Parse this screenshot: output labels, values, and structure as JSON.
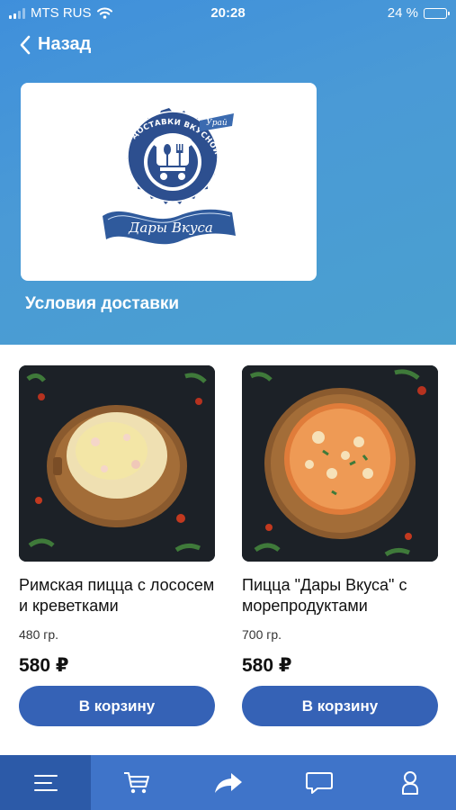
{
  "status_bar": {
    "carrier": "MTS RUS",
    "time": "20:28",
    "battery": "24 %",
    "battery_level": 0.24
  },
  "nav": {
    "back_label": "Назад"
  },
  "store": {
    "logo_arc_text": "СЛУЖБА ДОСТАВКИ ВКУСНОЙ ЕДЫ",
    "logo_ribbon_text": "Дары Вкуса",
    "logo_corner_text": "Урай",
    "delivery_link": "Условия доставки"
  },
  "products": [
    {
      "name": "Римская пицца с лососем и креветками",
      "weight": "480 гр.",
      "price": "580 ₽",
      "button": "В корзину"
    },
    {
      "name": "Пицца \"Дары Вкуса\" с морепродуктами",
      "weight": "700 гр.",
      "price": "580 ₽",
      "button": "В корзину"
    }
  ],
  "tabs": [
    {
      "icon": "menu-icon",
      "active": true
    },
    {
      "icon": "cart-icon",
      "active": false
    },
    {
      "icon": "share-icon",
      "active": false
    },
    {
      "icon": "chat-icon",
      "active": false
    },
    {
      "icon": "profile-icon",
      "active": false
    }
  ],
  "colors": {
    "header": "#4a9ad6",
    "button": "#3562b6",
    "tabbar": "#3f74c9",
    "tab_active": "#2c5aa8"
  }
}
